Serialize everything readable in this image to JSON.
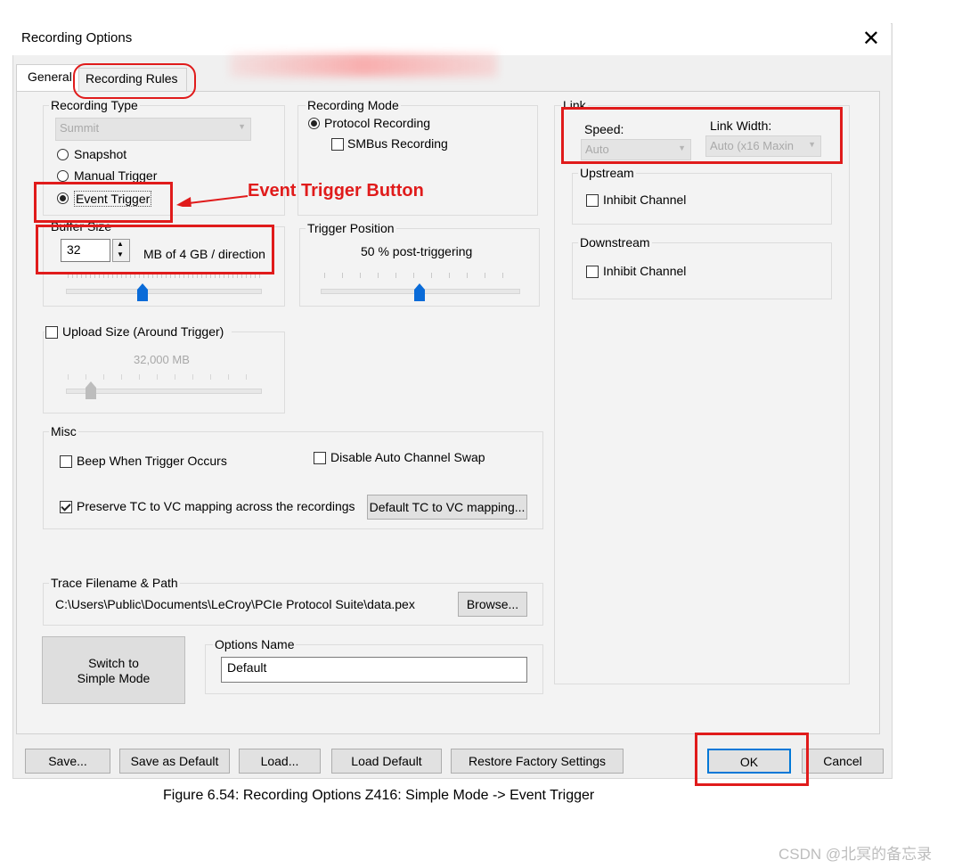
{
  "dialog": {
    "title": "Recording Options",
    "close_symbol": "✕"
  },
  "tabs": [
    "General",
    "Recording Rules"
  ],
  "recording_type": {
    "label": "Recording Type",
    "device": "Summit",
    "options": [
      "Snapshot",
      "Manual Trigger",
      "Event Trigger"
    ],
    "selected": "Event Trigger"
  },
  "recording_mode": {
    "label": "Recording Mode",
    "protocol": "Protocol Recording",
    "smbus": "SMBus Recording"
  },
  "link": {
    "label": "Link",
    "speed_label": "Speed:",
    "speed_value": "Auto",
    "width_label": "Link Width:",
    "width_value": "Auto (x16 Maxin",
    "upstream_label": "Upstream",
    "upstream_inhibit": "Inhibit Channel",
    "downstream_label": "Downstream",
    "downstream_inhibit": "Inhibit Channel"
  },
  "buffer": {
    "label": "Buffer Size",
    "value": "32",
    "unit": "MB of 4 GB / direction"
  },
  "trigger_position": {
    "label": "Trigger Position",
    "text": "50 % post-triggering",
    "level_percent": 50
  },
  "upload": {
    "label": "Upload Size (Around Trigger)",
    "value": "32,000 MB"
  },
  "misc": {
    "label": "Misc",
    "beep": "Beep When Trigger Occurs",
    "disable_swap": "Disable Auto Channel Swap",
    "preserve": "Preserve TC to VC mapping across the recordings",
    "default_tc": "Default TC to VC mapping..."
  },
  "trace": {
    "label": "Trace Filename & Path",
    "path": "C:\\Users\\Public\\Documents\\LeCroy\\PCIe Protocol Suite\\data.pex",
    "browse": "Browse..."
  },
  "switch_mode": {
    "line1": "Switch to",
    "line2": "Simple Mode"
  },
  "options_name": {
    "label": "Options Name",
    "value": "Default"
  },
  "footer_buttons": {
    "save": "Save...",
    "save_default": "Save as Default",
    "load": "Load...",
    "load_default": "Load Default",
    "restore": "Restore Factory Settings",
    "ok": "OK",
    "cancel": "Cancel"
  },
  "annotation": {
    "text": "Event Trigger Button",
    "color": "#e01b1b"
  },
  "caption": "Figure 6.54:  Recording Options Z416: Simple Mode -> Event Trigger",
  "watermark": "CSDN @北冥的备忘录"
}
